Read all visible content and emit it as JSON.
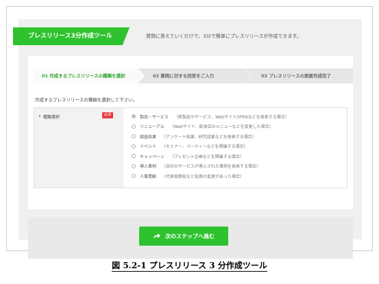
{
  "header": {
    "tag_label": "プレスリリース3分作成ツール",
    "description": "質問に答えていくだけで、3分で簡単にプレスリリースが作成できます。"
  },
  "steps": [
    {
      "label": "01  作成するプレスリリースの種類を選択",
      "active": true
    },
    {
      "label": "02  質問に対する回答をご入力",
      "active": false
    },
    {
      "label": "03  プレスリリースの原案作成完了",
      "active": false
    }
  ],
  "instruction": "作成するプレスリリースの種類を選択して下さい。",
  "form": {
    "field_label": "種類選択",
    "required_badge": "必須",
    "options": [
      {
        "name": "製品・サービス",
        "desc": "（新製品やサービス、WebサイトOPENなどを発表する場合）",
        "checked": true
      },
      {
        "name": "リニューアル",
        "desc": "（Webサイト、飲食店のメニューなどを変更した場合）",
        "checked": false
      },
      {
        "name": "調査結果",
        "desc": "（アンケート結果、研究成果などを発表する場合）",
        "checked": false
      },
      {
        "name": "イベント",
        "desc": "（セミナー、パーティーなどを開催する場合）",
        "checked": false
      },
      {
        "name": "キャンペーン",
        "desc": "（プレゼント企画などを開催する場合）",
        "checked": false
      },
      {
        "name": "導入事例",
        "desc": "（自社のサービスが導入された事例を発表する場合）",
        "checked": false
      },
      {
        "name": "人事異動",
        "desc": "（代表取締役など役員の変更があった場合）",
        "checked": false
      }
    ]
  },
  "next_button": {
    "label": "次のステップへ進む",
    "icon": "share-arrow-icon"
  },
  "caption": "図 5.2-1  プレスリリース 3 分作成ツール",
  "colors": {
    "accent": "#2fc22f",
    "required": "#e63c3c"
  }
}
